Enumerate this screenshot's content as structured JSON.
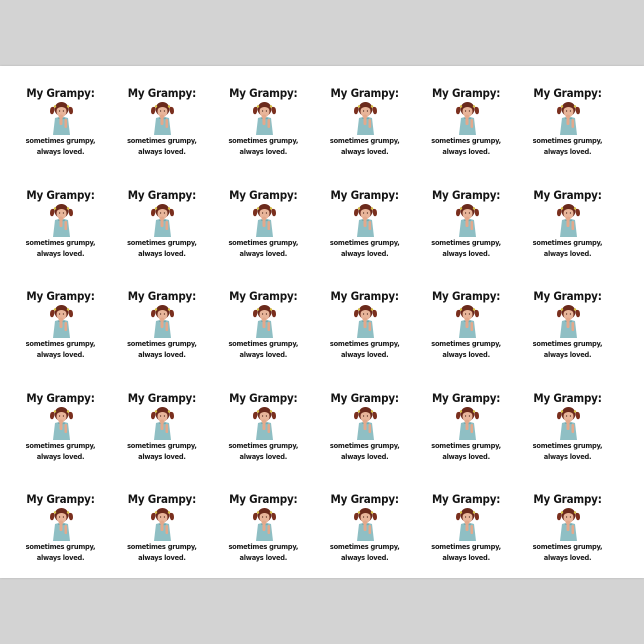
{
  "design": {
    "title": "My Grampy:",
    "caption_line1": "sometimes grumpy,",
    "caption_line2": "always loved."
  },
  "layout_grid": {
    "rows": 5,
    "columns": 6
  },
  "colors": {
    "background": "#d3d3d3",
    "sheet": "#ffffff",
    "text": "#141414",
    "dress": "#8fbfc4",
    "hair": "#6b2a1c",
    "skin": "#e8b59a"
  },
  "icons": {
    "photo": "girl-photo-icon"
  }
}
